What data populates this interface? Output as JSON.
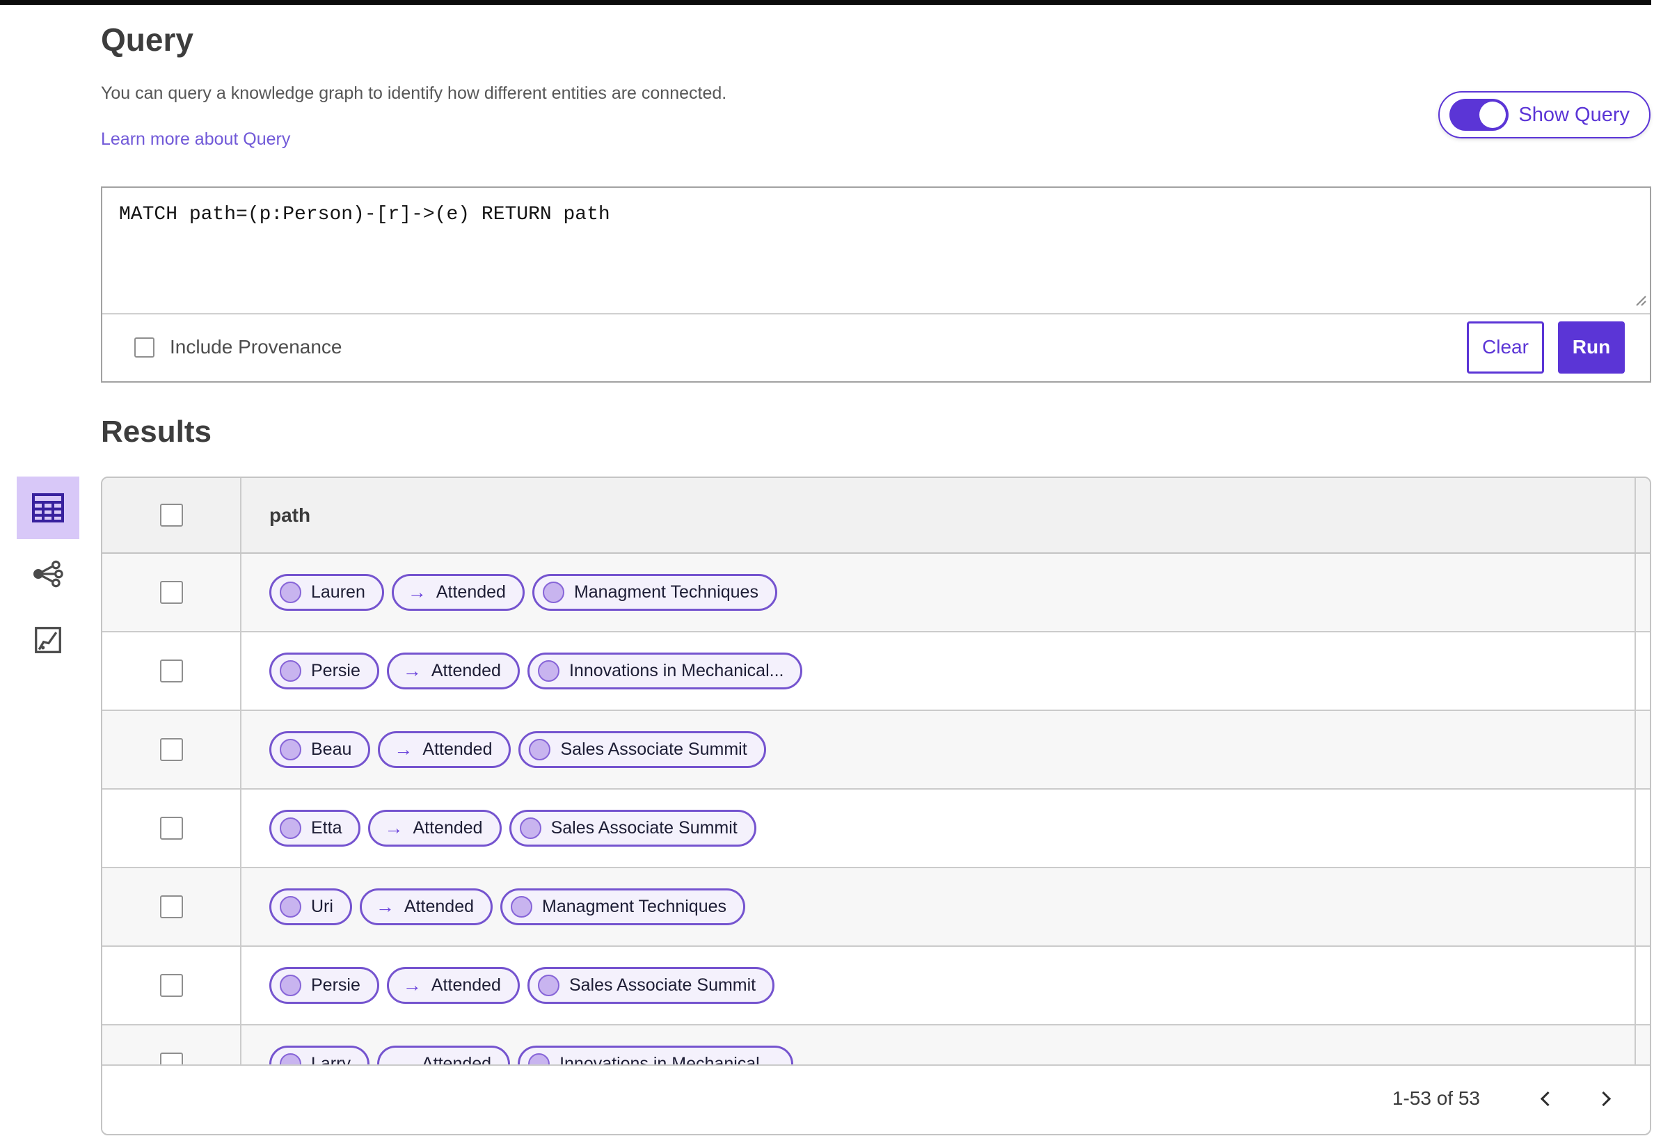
{
  "query_section": {
    "title": "Query",
    "description": "You can query a knowledge graph to identify how different entities are connected.",
    "learn_more_link": "Learn more about Query",
    "show_query_toggle": {
      "label": "Show Query",
      "state": "on"
    },
    "editor": {
      "query_text": "MATCH path=(p:Person)-[r]->(e) RETURN path",
      "include_provenance": {
        "label": "Include Provenance",
        "checked": false
      },
      "clear_button": "Clear",
      "run_button": "Run"
    }
  },
  "results_section": {
    "title": "Results",
    "view_switcher": [
      {
        "id": "table-view",
        "icon": "table-icon",
        "selected": true
      },
      {
        "id": "graph-view",
        "icon": "graph-icon",
        "selected": false
      },
      {
        "id": "chart-view",
        "icon": "chart-icon",
        "selected": false
      }
    ],
    "table": {
      "columns": [
        "path"
      ],
      "rows": [
        {
          "source": "Lauren",
          "edge": "Attended",
          "target": "Managment Techniques"
        },
        {
          "source": "Persie",
          "edge": "Attended",
          "target": "Innovations in Mechanical..."
        },
        {
          "source": "Beau",
          "edge": "Attended",
          "target": "Sales Associate Summit"
        },
        {
          "source": "Etta",
          "edge": "Attended",
          "target": "Sales Associate Summit"
        },
        {
          "source": "Uri",
          "edge": "Attended",
          "target": "Managment Techniques"
        },
        {
          "source": "Persie",
          "edge": "Attended",
          "target": "Sales Associate Summit"
        },
        {
          "source": "Larry",
          "edge": "Attended",
          "target": "Innovations in Mechanical..."
        }
      ]
    },
    "pagination": {
      "range_label": "1-53 of 53"
    }
  },
  "icons": {
    "edge_arrow": "→"
  },
  "colors": {
    "accent": "#5b35d6",
    "link": "#7159d8",
    "pill_border": "#7554cf",
    "pill_bg": "#f4f1fc",
    "node_fill": "#c8b4ef",
    "node_border": "#8765d8",
    "selected_view_bg": "#d8c8f8",
    "header_bg": "#f1f1f1",
    "row_alt_bg": "#f7f7f7"
  }
}
